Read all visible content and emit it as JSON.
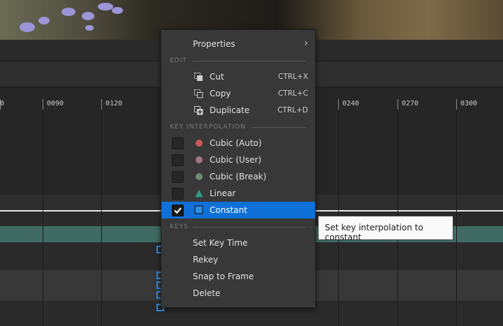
{
  "timeline": {
    "ruler_ticks": [
      "0",
      "0090",
      "0120",
      "0240",
      "0270",
      "0300"
    ]
  },
  "menu": {
    "properties_label": "Properties",
    "sections": {
      "edit": "EDIT",
      "key_interpolation": "KEY INTERPOLATION",
      "keys": "KEYS"
    },
    "edit_items": [
      {
        "label": "Cut",
        "shortcut": "CTRL+X",
        "icon": "cut-icon"
      },
      {
        "label": "Copy",
        "shortcut": "CTRL+C",
        "icon": "copy-icon"
      },
      {
        "label": "Duplicate",
        "shortcut": "CTRL+D",
        "icon": "duplicate-icon"
      }
    ],
    "interpolation_items": [
      {
        "label": "Cubic (Auto)",
        "checked": false,
        "icon": "circle-icon",
        "color": "#c85a5a"
      },
      {
        "label": "Cubic (User)",
        "checked": false,
        "icon": "circle-icon",
        "color": "#a07a86"
      },
      {
        "label": "Cubic (Break)",
        "checked": false,
        "icon": "circle-icon",
        "color": "#6e8a78"
      },
      {
        "label": "Linear",
        "checked": false,
        "icon": "triangle-icon",
        "color": "#2e9a82"
      },
      {
        "label": "Constant",
        "checked": true,
        "icon": "square-icon",
        "color": "#2e8ee0"
      }
    ],
    "key_items": [
      {
        "label": "Set Key Time"
      },
      {
        "label": "Rekey"
      },
      {
        "label": "Snap to Frame"
      },
      {
        "label": "Delete"
      }
    ]
  },
  "tooltip": {
    "text": "Set key interpolation to constant"
  },
  "colors": {
    "accent": "#0f70d7",
    "key_outline": "#2c8ef0",
    "track_teal": "#3f6b63"
  }
}
